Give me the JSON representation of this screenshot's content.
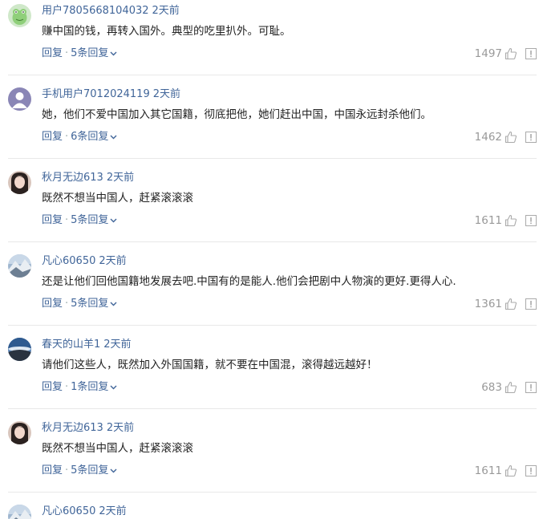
{
  "comments": [
    {
      "user": "用户7805668104032",
      "time": "2天前",
      "text": "赚中国的钱，再转入国外。典型的吃里扒外。可耻。",
      "reply_label": "回复",
      "replies": "5条回复",
      "likes": "1497",
      "avatar_icon": "frog-avatar-icon"
    },
    {
      "user": "手机用户7012024119",
      "time": "2天前",
      "text": "她，他们不爱中国加入其它国籍，彻底把他，她们赶出中国，中国永远封杀他们。",
      "reply_label": "回复",
      "replies": "6条回复",
      "likes": "1462",
      "avatar_icon": "default-user-avatar-icon"
    },
    {
      "user": "秋月无边613",
      "time": "2天前",
      "text": "既然不想当中国人，赶紧滚滚滚",
      "reply_label": "回复",
      "replies": "5条回复",
      "likes": "1611",
      "avatar_icon": "woman-photo-avatar-icon"
    },
    {
      "user": "凡心60650",
      "time": "2天前",
      "text": "还是让他们回他国籍地发展去吧.中国有的是能人.他们会把剧中人物演的更好.更得人心.",
      "reply_label": "回复",
      "replies": "5条回复",
      "likes": "1361",
      "avatar_icon": "mountain-snow-avatar-icon"
    },
    {
      "user": "春天的山羊1",
      "time": "2天前",
      "text": "请他们这些人，既然加入外国国籍，就不要在中国混，滚得越远越好！",
      "reply_label": "回复",
      "replies": "1条回复",
      "likes": "683",
      "avatar_icon": "sky-landscape-avatar-icon"
    },
    {
      "user": "秋月无边613",
      "time": "2天前",
      "text": "既然不想当中国人，赶紧滚滚滚",
      "reply_label": "回复",
      "replies": "5条回复",
      "likes": "1611",
      "avatar_icon": "woman-photo-avatar-icon"
    },
    {
      "user": "凡心60650",
      "time": "2天前",
      "avatar_icon": "mountain-snow-avatar-icon"
    }
  ],
  "colors": {
    "username": "#406599",
    "text": "#222222",
    "muted": "#999999",
    "divider": "#e8e8e8"
  }
}
